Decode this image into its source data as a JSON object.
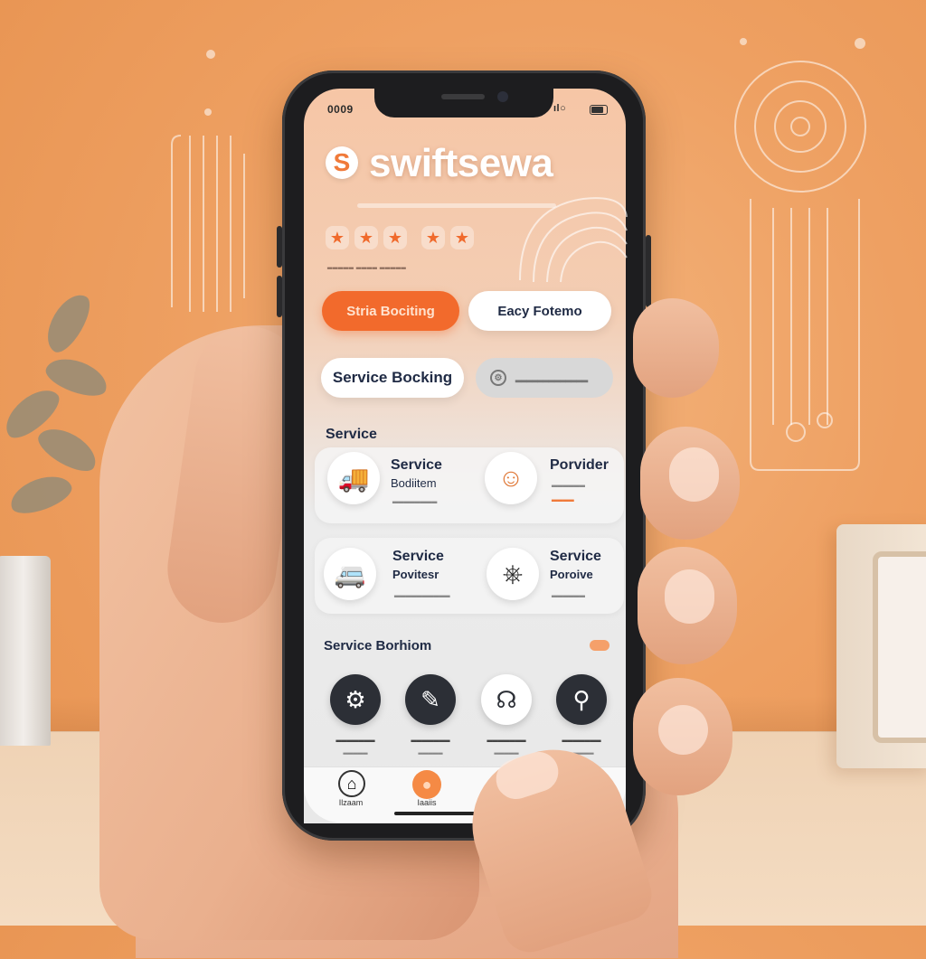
{
  "status_bar": {
    "time": "0009",
    "signal": "ıl○"
  },
  "app": {
    "logo_glyph": "S",
    "brand_name": "swiftsewa",
    "rating_stars": [
      "★",
      "★",
      "★",
      "★",
      "★"
    ],
    "reviews_text": "▂▂▂▂▂ ▂▂▂▂ ▂▂▂▂▂"
  },
  "quick_actions": {
    "primary": "Stria Bociting",
    "secondary": "Eacy Fotemo",
    "service_booking": "Service Bocking",
    "grey_pill": "▂▂▂▂▂▂▂▂▂▂▂▂▂"
  },
  "services_section": {
    "title": "Service",
    "cards": [
      {
        "title": "Service",
        "title2": "Bodiitem",
        "sub": "▂▂▂▂▂▂▂▂",
        "icon": "truck-icon",
        "glyph": "🚚"
      },
      {
        "title": "Porvider",
        "title2": "",
        "sub": "▂▂▂▂▂▂",
        "sub2": "▂▂▂▂",
        "icon": "smile-icon",
        "glyph": "☺"
      },
      {
        "title": "Service",
        "title2": "Povitesr",
        "sub": "▂▂▂▂▂▂▂▂▂▂",
        "icon": "van-icon",
        "glyph": "🚐"
      },
      {
        "title": "Service",
        "title2": "Poroive",
        "sub": "▂▂▂▂▂▂",
        "icon": "steering-icon",
        "glyph": "⎈"
      }
    ]
  },
  "booking_section": {
    "title": "Service Borhiom",
    "items": [
      {
        "label": "▂▂▂▂▂▂▂",
        "sublabel": "▂▂▂▂▂",
        "icon": "car-icon",
        "glyph": "⚙"
      },
      {
        "label": "▂▂▂▂▂▂▂",
        "sublabel": "▂▂▂▂▂",
        "icon": "wrench-icon",
        "glyph": "✎"
      },
      {
        "label": "▂▂▂▂▂▂▂",
        "sublabel": "▂▂▂▂▂",
        "icon": "headset-icon",
        "glyph": "☊"
      },
      {
        "label": "▂▂▂▂▂▂▂",
        "sublabel": "▂▂▂▂▂",
        "icon": "pin-icon",
        "glyph": "⚲"
      }
    ]
  },
  "tabbar": {
    "tabs": [
      {
        "label": "Ilzaam",
        "icon": "home-icon",
        "glyph": "⌂"
      },
      {
        "label": "Iaaiis",
        "icon": "bookings-icon",
        "glyph": "●"
      }
    ]
  },
  "colors": {
    "accent": "#f26a2c",
    "navy": "#1f2a44",
    "background": "#eea062"
  }
}
